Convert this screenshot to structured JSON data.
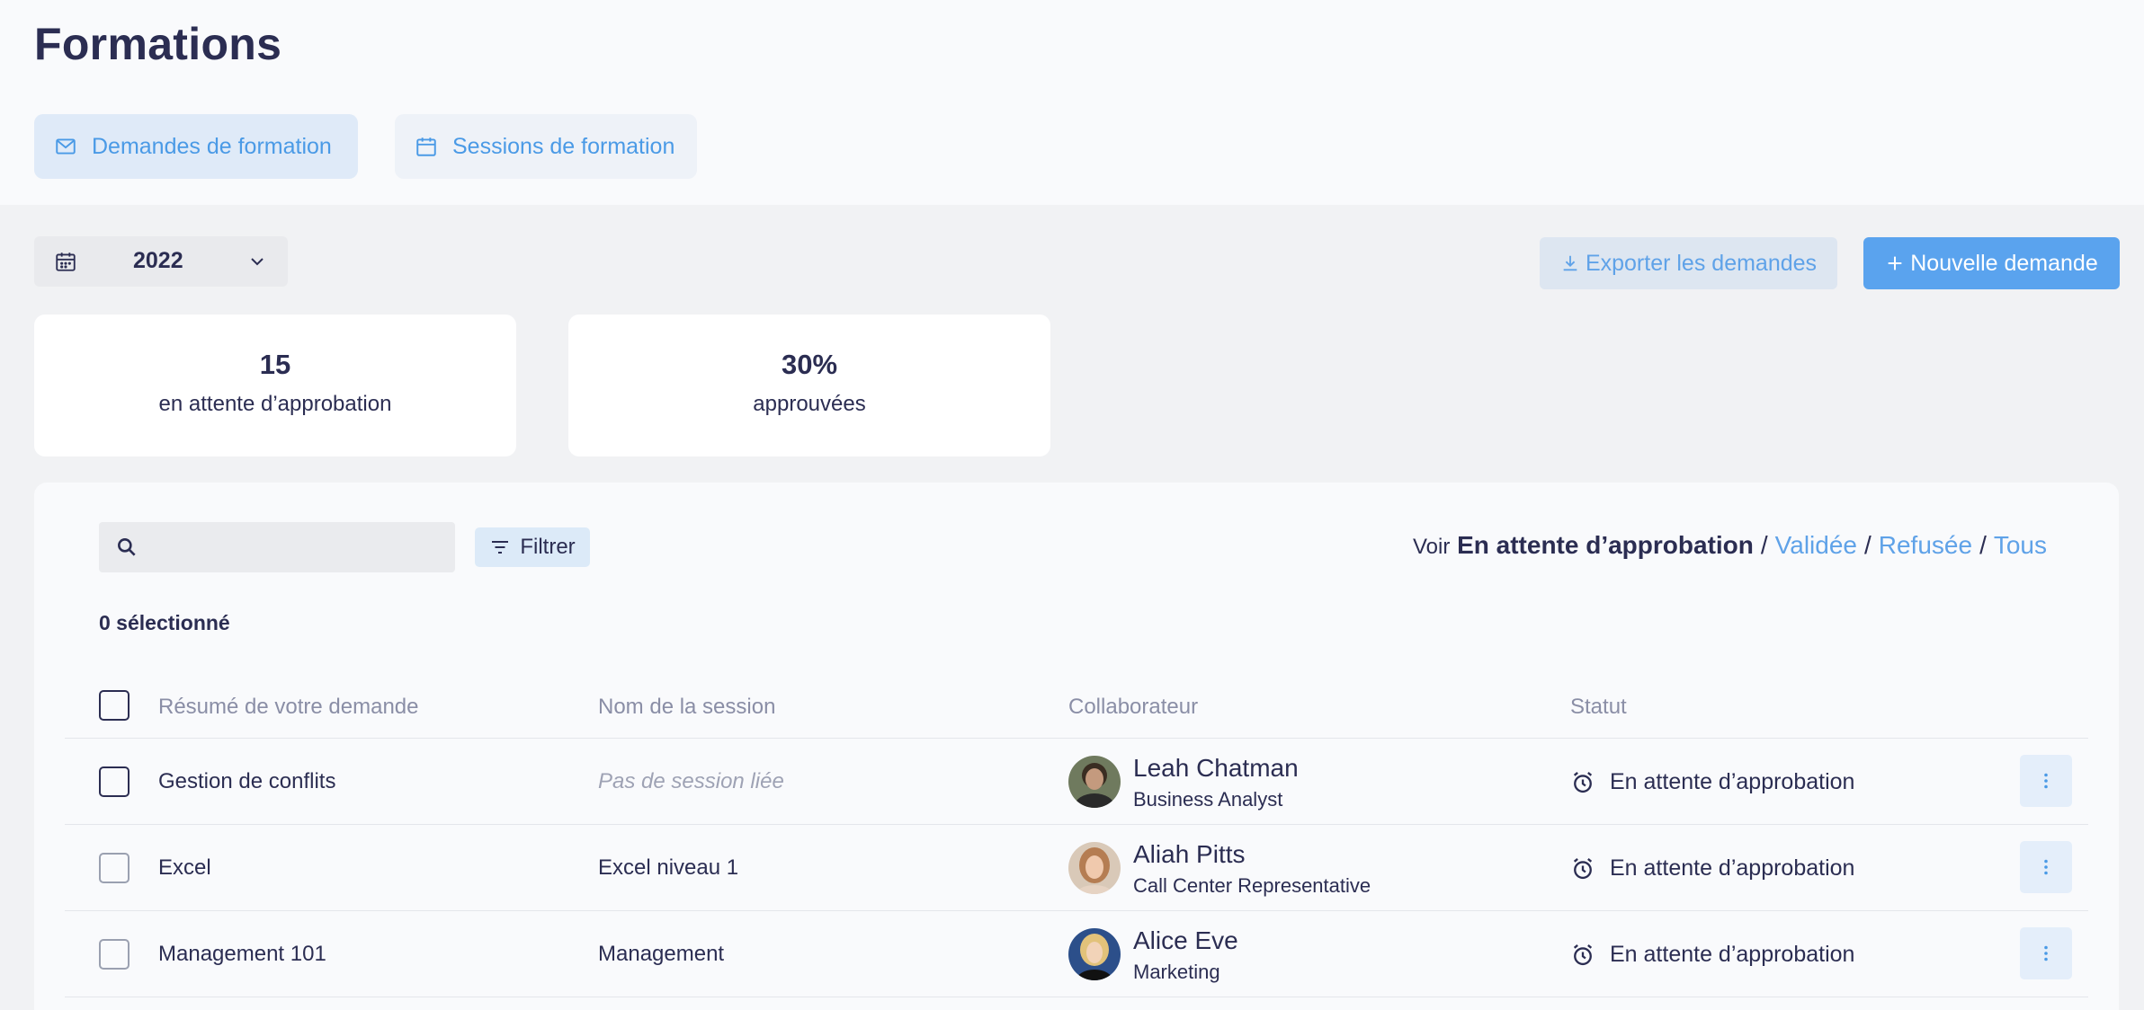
{
  "page": {
    "title": "Formations"
  },
  "tabs": [
    {
      "label": "Demandes de formation",
      "icon": "mail-icon",
      "active": true
    },
    {
      "label": "Sessions de formation",
      "icon": "calendar-icon",
      "active": false
    }
  ],
  "toolbar": {
    "year": "2022",
    "export_label": "Exporter les demandes",
    "new_label": "Nouvelle demande"
  },
  "stats": [
    {
      "value": "15",
      "label": "en attente d’approbation"
    },
    {
      "value": "30%",
      "label": "approuvées"
    }
  ],
  "list": {
    "search": {
      "placeholder": "",
      "value": ""
    },
    "filter_label": "Filtrer",
    "view": {
      "prefix": "Voir",
      "current": "En attente d’approbation",
      "options": [
        "Validée",
        "Refusée",
        "Tous"
      ]
    },
    "selected_count": "0 sélectionné",
    "columns": [
      "Résumé de votre demande",
      "Nom de la session",
      "Collaborateur",
      "Statut"
    ],
    "rows": [
      {
        "summary": "Gestion de conflits",
        "session": "Pas de session liée",
        "session_linked": false,
        "name": "Leah Chatman",
        "role": "Business Analyst",
        "status": "En attente d’approbation"
      },
      {
        "summary": "Excel",
        "session": "Excel niveau 1",
        "session_linked": true,
        "name": "Aliah Pitts",
        "role": "Call Center Representative",
        "status": "En attente d’approbation"
      },
      {
        "summary": "Management 101",
        "session": "Management",
        "session_linked": true,
        "name": "Alice Eve",
        "role": "Marketing",
        "status": "En attente d’approbation"
      }
    ]
  },
  "colors": {
    "primary": "#5aa3ee",
    "link": "#5fa2e8",
    "text": "#2b2d52",
    "muted": "#8a8ea6",
    "background": "#f1f2f4",
    "surface": "#f9fafc"
  }
}
